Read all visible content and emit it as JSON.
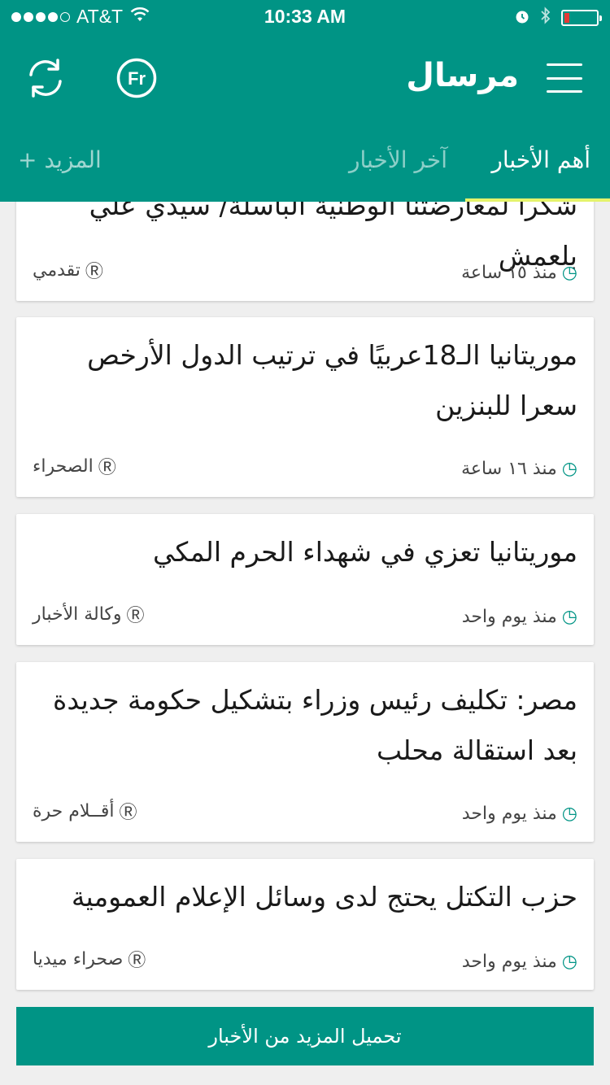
{
  "status_bar": {
    "carrier": "AT&T",
    "time": "10:33 AM",
    "battery_color": "#e53935"
  },
  "toolbar": {
    "app_title": "مرسال",
    "refresh_icon": "refresh-icon",
    "language_icon_label": "Fr",
    "menu_icon": "hamburger-menu-icon"
  },
  "tabs": {
    "items": [
      {
        "label": "أهم الأخبار",
        "active": true
      },
      {
        "label": "آخر الأخبار",
        "active": false
      }
    ],
    "more_label": "+ المزيد",
    "indicator_color": "#e4f36b"
  },
  "colors": {
    "primary": "#009485",
    "background": "#efefef"
  },
  "articles": [
    {
      "title": "شكرا لمعارضتنا الوطنية الباسلة/ سيدي علي بلعمش",
      "time": "منذ ١٥ ساعة",
      "source": "تقدمي"
    },
    {
      "title": "موريتانيا الـ18عربيًا في ترتيب الدول الأرخص سعرا للبنزين",
      "time": "منذ ١٦ ساعة",
      "source": "الصحراء"
    },
    {
      "title": "موريتانيا تعزي في شهداء الحرم المكي",
      "time": "منذ يوم واحد",
      "source": "وكالة الأخبار"
    },
    {
      "title": "مصر: تكليف رئيس وزراء بتشكيل حكومة جديدة بعد استقالة محلب",
      "time": "منذ يوم واحد",
      "source": "أقــلام حرة"
    },
    {
      "title": "حزب التكتل يحتج لدى وسائل الإعلام العمومية",
      "time": "منذ يوم واحد",
      "source": "صحراء ميديا"
    }
  ],
  "load_more_label": "تحميل المزيد من الأخبار"
}
